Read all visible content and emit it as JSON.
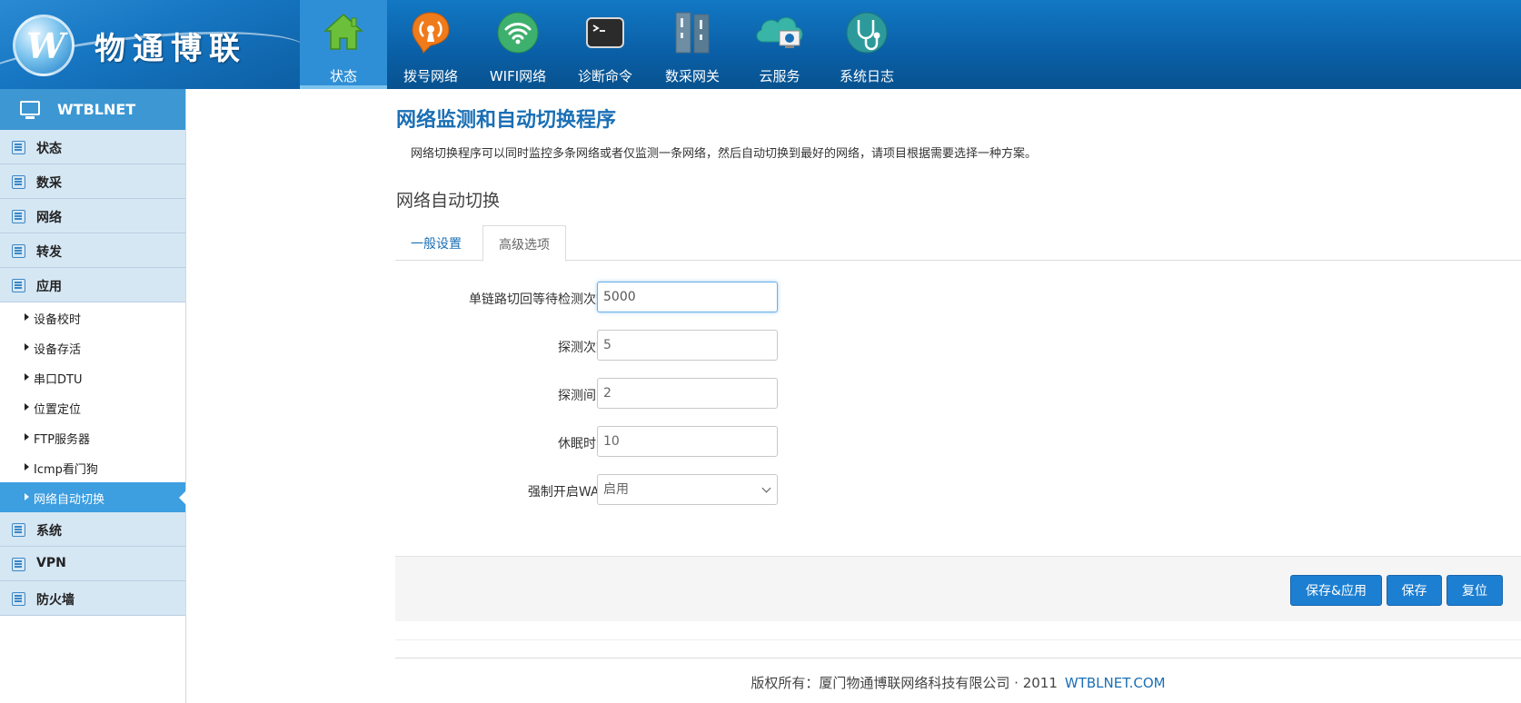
{
  "brand": {
    "logo_text": "物通博联",
    "logo_mark": "W"
  },
  "topnav": [
    {
      "label": "状态",
      "icon": "home-icon",
      "active": true
    },
    {
      "label": "拨号网络",
      "icon": "dialup-antenna-icon"
    },
    {
      "label": "WIFI网络",
      "icon": "wifi-icon"
    },
    {
      "label": "诊断命令",
      "icon": "terminal-icon"
    },
    {
      "label": "数采网关",
      "icon": "gateway-server-icon"
    },
    {
      "label": "云服务",
      "icon": "cloud-icon"
    },
    {
      "label": "系统日志",
      "icon": "stethoscope-icon"
    }
  ],
  "sidebar": {
    "header": "WTBLNET",
    "groups": [
      "状态",
      "数采",
      "网络",
      "转发",
      "应用"
    ],
    "app_items": [
      "设备校时",
      "设备存活",
      "串口DTU",
      "位置定位",
      "FTP服务器",
      "Icmp看门狗",
      "网络自动切换"
    ],
    "active_item": "网络自动切换",
    "groups_after": [
      "系统",
      "VPN",
      "防火墙"
    ]
  },
  "main": {
    "title": "网络监测和自动切换程序",
    "description": "网络切换程序可以同时监控多条网络或者仅监测一条网络，然后自动切换到最好的网络，请项目根据需要选择一种方案。",
    "section_title": "网络自动切换",
    "tabs": [
      "一般设置",
      "高级选项"
    ],
    "active_tab": "高级选项",
    "fields": [
      {
        "label": "单链路切回等待检测次数",
        "value": "5000"
      },
      {
        "label": "探测次数",
        "value": "5"
      },
      {
        "label": "探测间隔",
        "value": "2"
      },
      {
        "label": "休眠时间",
        "value": "10"
      }
    ],
    "select_field": {
      "label": "强制开启WAN",
      "value": "启用"
    },
    "buttons": {
      "save_apply": "保存&应用",
      "save": "保存",
      "reset": "复位"
    }
  },
  "footer": {
    "text": "版权所有：厦门物通博联网络科技有限公司 · 2011",
    "link": "WTBLNET.COM"
  },
  "colors": {
    "header_blue": "#0a5fa6",
    "accent": "#1d7fd1",
    "sidebar_group": "#d6e7f4",
    "active_item": "#3d9ee0"
  }
}
